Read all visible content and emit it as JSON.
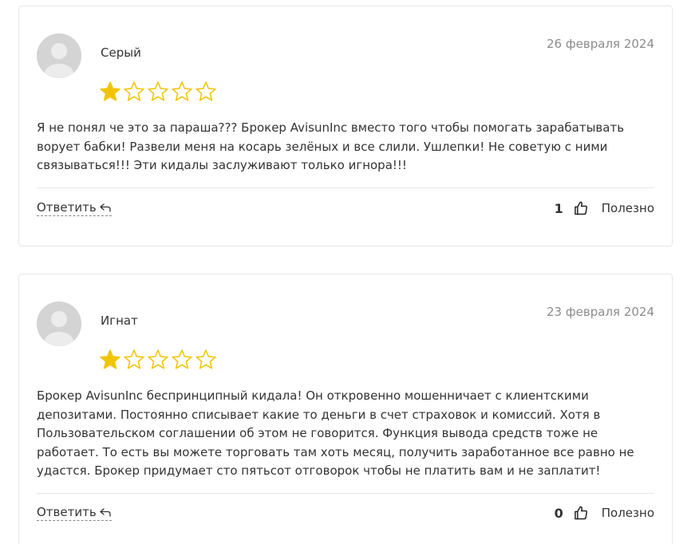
{
  "colors": {
    "star_filled": "#F2C400",
    "star_empty_outline": "#F2C400",
    "date_text": "#8C8C8C",
    "border": "#E7E7E7"
  },
  "reviews": [
    {
      "author": "Серый",
      "date": "26 февраля 2024",
      "rating": 1,
      "rating_max": 5,
      "text": "Я не понял че это за параша??? Брокер AvisunInc вместо того чтобы помогать зарабатывать ворует бабки! Развели меня на косарь зелёных и все слили. Ушлепки! Не советую с ними связываться!!! Эти кидалы заслуживают только игнора!!!",
      "reply_label": "Ответить",
      "likes": "1",
      "useful_label": "Полезно",
      "icons": {
        "avatar": "user-avatar-icon",
        "reply": "reply-arrow-icon",
        "like": "thumbs-up-icon",
        "star": "star-icon"
      }
    },
    {
      "author": "Игнат",
      "date": "23 февраля 2024",
      "rating": 1,
      "rating_max": 5,
      "text": "Брокер AvisunInc беспринципный кидала! Он откровенно мошенничает с клиентскими депозитами. Постоянно списывает какие то деньги в счет страховок и комиссий. Хотя в Пользовательском соглашении об этом не говорится. Функция вывода средств тоже не работает. То есть вы можете торговать там хоть месяц, получить заработанное все равно не удастся. Брокер придумает сто пятьсот отговорок чтобы не платить вам и не заплатит!",
      "reply_label": "Ответить",
      "likes": "0",
      "useful_label": "Полезно",
      "icons": {
        "avatar": "user-avatar-icon",
        "reply": "reply-arrow-icon",
        "like": "thumbs-up-icon",
        "star": "star-icon"
      }
    }
  ]
}
